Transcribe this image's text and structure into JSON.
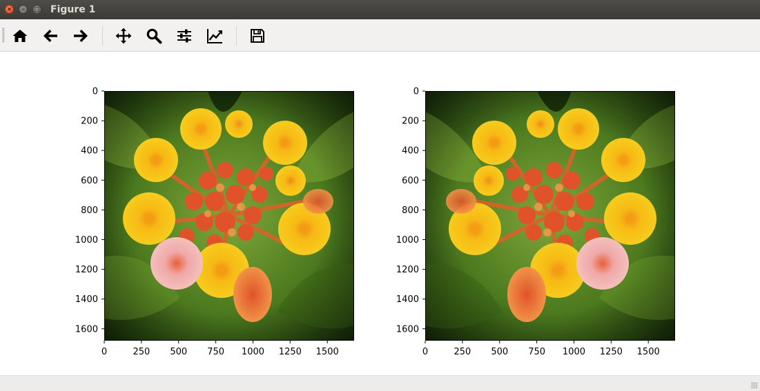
{
  "window": {
    "title": "Figure 1",
    "close_glyph": "×",
    "minimize_glyph": "–",
    "maximize_glyph": "□"
  },
  "toolbar": {
    "buttons": [
      {
        "name": "home",
        "icon": "home-icon"
      },
      {
        "name": "back",
        "icon": "arrow-left-icon"
      },
      {
        "name": "forward",
        "icon": "arrow-right-icon"
      },
      {
        "name": "pan",
        "icon": "move-arrows-icon"
      },
      {
        "name": "zoom",
        "icon": "magnifier-icon"
      },
      {
        "name": "configure-subplots",
        "icon": "sliders-icon"
      },
      {
        "name": "edit-axes",
        "icon": "line-chart-icon"
      },
      {
        "name": "save",
        "icon": "floppy-disk-icon"
      }
    ]
  },
  "figure": {
    "subplots": [
      {
        "name": "left-image",
        "content": "lantana flower cluster photo (original)",
        "xlim": [
          0,
          1680
        ],
        "ylim": [
          1680,
          0
        ],
        "xticks": [
          0,
          250,
          500,
          750,
          1000,
          1250,
          1500
        ],
        "xtick_labels": [
          "0",
          "250",
          "500",
          "750",
          "1000",
          "1250",
          "1500"
        ],
        "yticks": [
          0,
          200,
          400,
          600,
          800,
          1000,
          1200,
          1400,
          1600
        ],
        "ytick_labels": [
          "0",
          "200",
          "400",
          "600",
          "800",
          "1000",
          "1200",
          "1400",
          "1600"
        ]
      },
      {
        "name": "right-image",
        "content": "lantana flower cluster photo (horizontally mirrored)",
        "xlim": [
          0,
          1680
        ],
        "ylim": [
          1680,
          0
        ],
        "xticks": [
          0,
          250,
          500,
          750,
          1000,
          1250,
          1500
        ],
        "xtick_labels": [
          "0",
          "250",
          "500",
          "750",
          "1000",
          "1250",
          "1500"
        ],
        "yticks": [
          0,
          200,
          400,
          600,
          800,
          1000,
          1200,
          1400,
          1600
        ],
        "ytick_labels": [
          "0",
          "200",
          "400",
          "600",
          "800",
          "1000",
          "1200",
          "1400",
          "1600"
        ]
      }
    ],
    "colors": {
      "leaf_dark": "#1f3d0c",
      "leaf_mid": "#4d7a1f",
      "leaf_light": "#7fa83a",
      "petal_yellow": "#f7c613",
      "petal_orange": "#f08a1c",
      "bud_red": "#e0532a",
      "petal_pink": "#f0a8a8"
    }
  }
}
